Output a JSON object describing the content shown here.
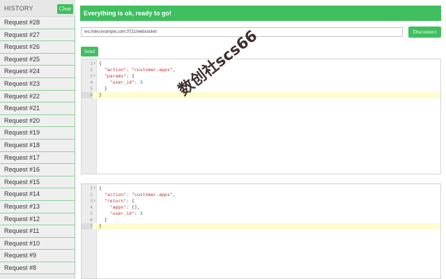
{
  "sidebar": {
    "title": "HISTORY",
    "clear_label": "Clear",
    "items": [
      {
        "label": "Request #28"
      },
      {
        "label": "Request #27"
      },
      {
        "label": "Request #26"
      },
      {
        "label": "Request #25"
      },
      {
        "label": "Request #24"
      },
      {
        "label": "Request #23"
      },
      {
        "label": "Request #22"
      },
      {
        "label": "Request #21"
      },
      {
        "label": "Request #20"
      },
      {
        "label": "Request #19"
      },
      {
        "label": "Request #18"
      },
      {
        "label": "Request #17"
      },
      {
        "label": "Request #16"
      },
      {
        "label": "Request #15"
      },
      {
        "label": "Request #14"
      },
      {
        "label": "Request #13"
      },
      {
        "label": "Request #12"
      },
      {
        "label": "Request #11"
      },
      {
        "label": "Request #10"
      },
      {
        "label": "Request #9"
      },
      {
        "label": "Request #8"
      }
    ]
  },
  "status": {
    "message": "Everything is ok, ready to go!"
  },
  "connection": {
    "url": "ws://dev.example.com:3721/websocket",
    "disconnect_label": "Disconnect"
  },
  "send_label": "Send",
  "request_editor": {
    "lines": [
      {
        "no": "1",
        "fold": "▾",
        "tokens": [
          {
            "t": "{",
            "c": "punc"
          }
        ]
      },
      {
        "no": "2",
        "fold": "",
        "tokens": [
          {
            "t": "  ",
            "c": "punc"
          },
          {
            "t": "\"action\"",
            "c": "key"
          },
          {
            "t": ": ",
            "c": "punc"
          },
          {
            "t": "\"customer.apps\"",
            "c": "str"
          },
          {
            "t": ",",
            "c": "punc"
          }
        ]
      },
      {
        "no": "3",
        "fold": "▾",
        "tokens": [
          {
            "t": "  ",
            "c": "punc"
          },
          {
            "t": "\"params\"",
            "c": "key"
          },
          {
            "t": ": {",
            "c": "punc"
          }
        ]
      },
      {
        "no": "4",
        "fold": "",
        "tokens": [
          {
            "t": "    ",
            "c": "punc"
          },
          {
            "t": "\"user_id\"",
            "c": "key"
          },
          {
            "t": ": ",
            "c": "punc"
          },
          {
            "t": "3",
            "c": "num"
          }
        ]
      },
      {
        "no": "5",
        "fold": "",
        "tokens": [
          {
            "t": "  }",
            "c": "punc"
          }
        ]
      },
      {
        "no": "6",
        "fold": "",
        "tokens": [
          {
            "t": "}",
            "c": "punc"
          }
        ],
        "active": true
      }
    ]
  },
  "response_editor": {
    "lines": [
      {
        "no": "1",
        "fold": "▾",
        "tokens": [
          {
            "t": "{",
            "c": "punc"
          }
        ]
      },
      {
        "no": "2",
        "fold": "",
        "tokens": [
          {
            "t": "  ",
            "c": "punc"
          },
          {
            "t": "\"action\"",
            "c": "key"
          },
          {
            "t": ": ",
            "c": "punc"
          },
          {
            "t": "\"customer.apps\"",
            "c": "str"
          },
          {
            "t": ",",
            "c": "punc"
          }
        ]
      },
      {
        "no": "3",
        "fold": "▾",
        "tokens": [
          {
            "t": "  ",
            "c": "punc"
          },
          {
            "t": "\"return\"",
            "c": "key"
          },
          {
            "t": ": {",
            "c": "punc"
          }
        ]
      },
      {
        "no": "4",
        "fold": "",
        "tokens": [
          {
            "t": "    ",
            "c": "punc"
          },
          {
            "t": "\"apps\"",
            "c": "key"
          },
          {
            "t": ": [],",
            "c": "punc"
          }
        ]
      },
      {
        "no": "5",
        "fold": "",
        "tokens": [
          {
            "t": "    ",
            "c": "punc"
          },
          {
            "t": "\"user_id\"",
            "c": "key"
          },
          {
            "t": ": ",
            "c": "punc"
          },
          {
            "t": "3",
            "c": "num"
          }
        ]
      },
      {
        "no": "6",
        "fold": "",
        "tokens": [
          {
            "t": "  }",
            "c": "punc"
          }
        ]
      },
      {
        "no": "7",
        "fold": "",
        "tokens": [
          {
            "t": "}",
            "c": "punc"
          }
        ],
        "active": true
      }
    ]
  },
  "watermark": "数创社scs66",
  "colors": {
    "accent": "#3fbf5f",
    "active_line": "#fffdd0"
  }
}
